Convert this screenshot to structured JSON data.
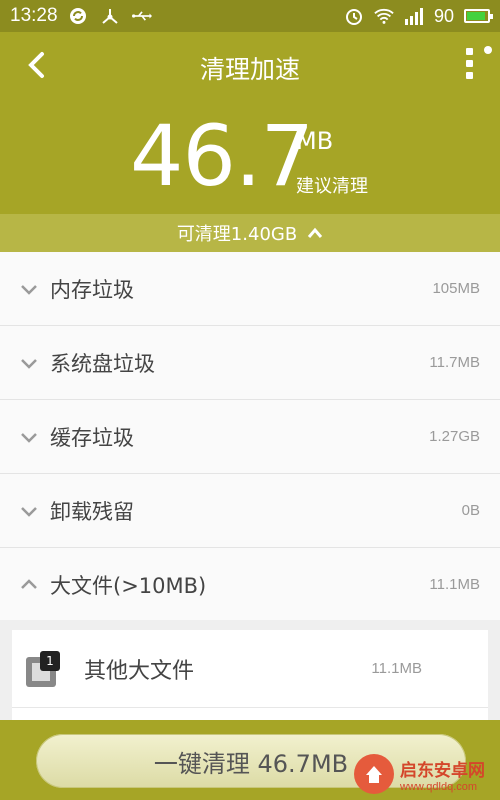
{
  "status_bar": {
    "time": "13:28",
    "battery_level": "90",
    "battery_fill_fraction": 0.9,
    "icons": [
      "sync-icon",
      "usb-debug-icon",
      "usb-icon",
      "alarm-icon",
      "wifi-icon",
      "signal-icon",
      "battery-icon"
    ]
  },
  "header": {
    "title": "清理加速",
    "amount": "46.7",
    "unit": "MB",
    "suggest_label": "建议清理",
    "cleanable_label": "可清理1.40GB",
    "colors": {
      "header_bg": "#a6a526",
      "subbar_bg": "#b7b646"
    }
  },
  "categories": [
    {
      "label": "内存垃圾",
      "size": "105MB",
      "expanded": false
    },
    {
      "label": "系统盘垃圾",
      "size": "11.7MB",
      "expanded": false
    },
    {
      "label": "缓存垃圾",
      "size": "1.27GB",
      "expanded": false
    },
    {
      "label": "卸载残留",
      "size": "0B",
      "expanded": false
    },
    {
      "label": "大文件(>10MB)",
      "size": "11.1MB",
      "expanded": true
    }
  ],
  "large_files": [
    {
      "badge": "1",
      "label": "其他大文件",
      "size": "11.1MB"
    }
  ],
  "bottom": {
    "button_label": "一键清理 46.7MB"
  },
  "watermark": {
    "name": "启东安卓网",
    "url": "www.qdldq.com"
  }
}
